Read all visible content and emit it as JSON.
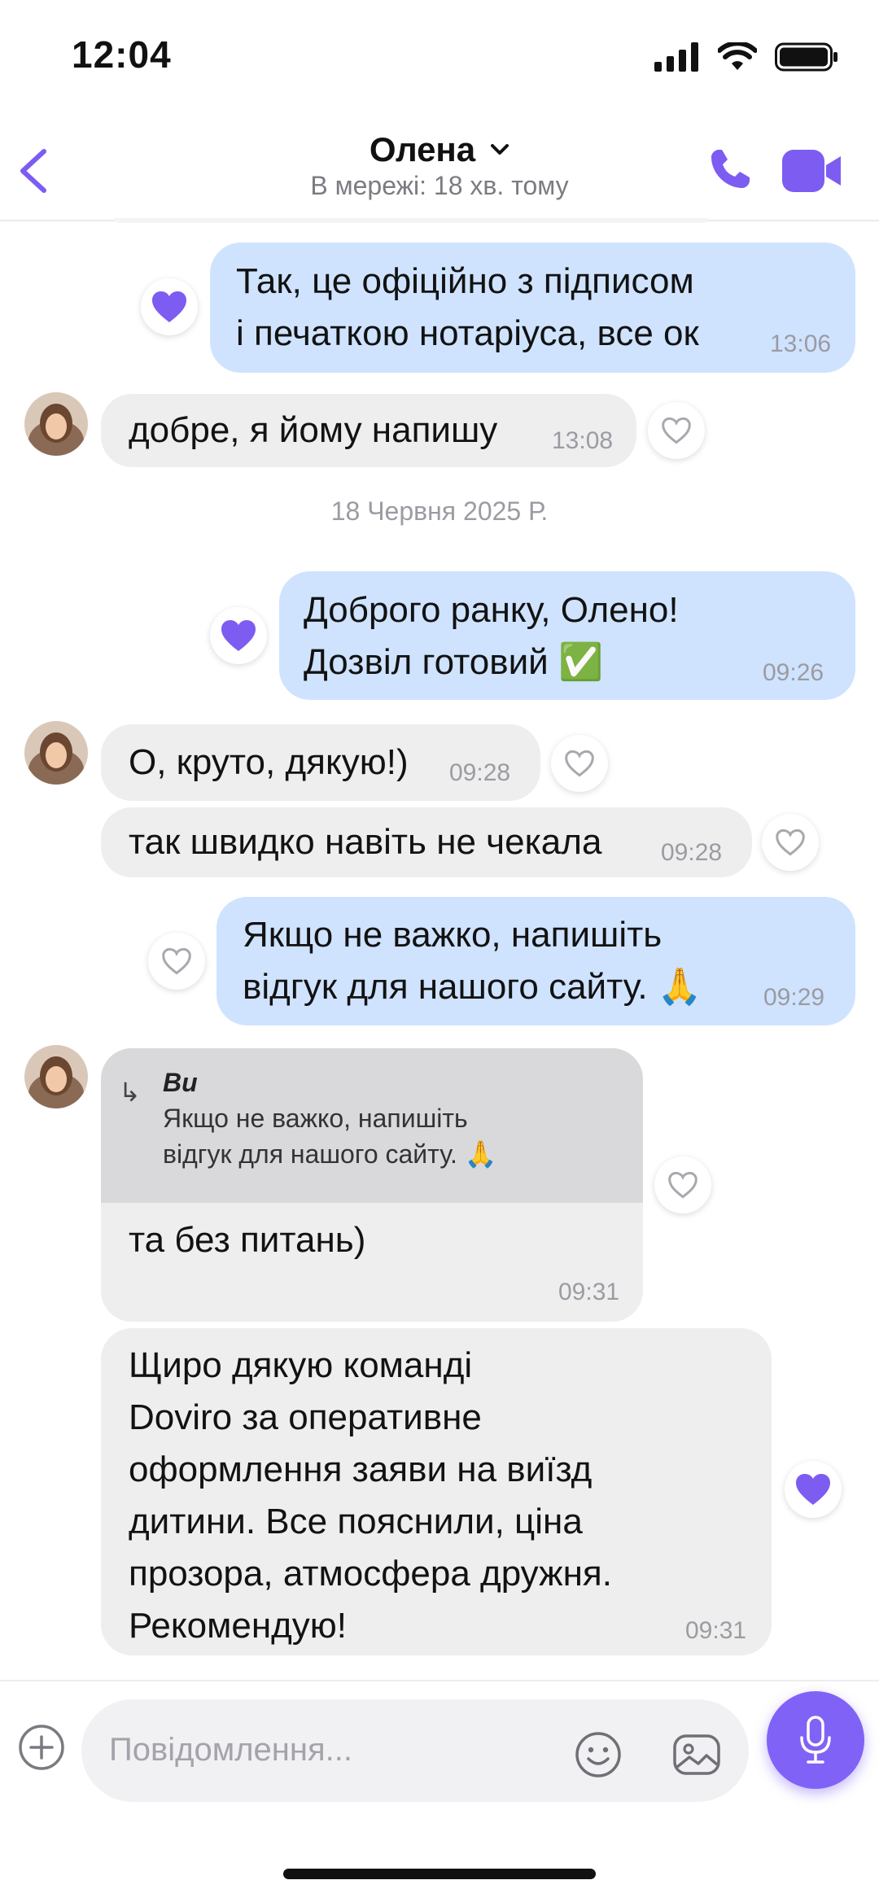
{
  "status_bar": {
    "time": "12:04"
  },
  "header": {
    "contact_name": "Олена",
    "presence": "В мережі: 18 хв. тому"
  },
  "accent_color": "#7d5cf2",
  "messages": [
    {
      "dir": "out",
      "text": "Так, це офіційно з підписом\nі печаткою нотаріуса, все ок",
      "time": "13:06",
      "liked": true
    },
    {
      "dir": "in",
      "text": "добре, я йому напишу",
      "time": "13:08",
      "liked": false
    },
    {
      "dir": "out",
      "text": " Доброго ранку, Олено!\nДозвіл готовий ✅",
      "time": "09:26",
      "liked": true
    },
    {
      "dir": "in",
      "text": "О, круто, дякую!)",
      "time": "09:28",
      "liked": false
    },
    {
      "dir": "in",
      "text": "так швидко навіть не чекала",
      "time": "09:28",
      "liked": false
    },
    {
      "dir": "out",
      "text": "Якщо не важко, напишіть\nвідгук для нашого сайту. 🙏",
      "time": "09:29",
      "liked": false
    },
    {
      "dir": "in",
      "quote_author": "Ви",
      "quote_text": "Якщо не важко, напишіть\nвідгук для нашого сайту. 🙏",
      "text": "та без питань)",
      "time": "09:31",
      "liked": false
    },
    {
      "dir": "in",
      "text": "Щиро дякую команді\nDoviro за оперативне\nоформлення заяви на виїзд\nдитини. Все пояснили, ціна\nпрозора, атмосфера дружня.\nРекомендую!",
      "time": "09:31",
      "liked": true
    }
  ],
  "date_separator": "18 Червня 2025 Р.",
  "composer": {
    "placeholder": "Повідомлення..."
  }
}
